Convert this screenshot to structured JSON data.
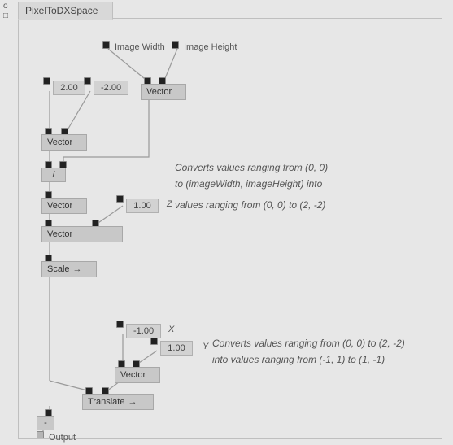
{
  "title": "PixelToDXSpace",
  "side": {
    "o": "o",
    "box": "□"
  },
  "inputs": {
    "image_width": "Image Width",
    "image_height": "Image Height"
  },
  "vals": {
    "two": "2.00",
    "neg_two": "-2.00",
    "one_z": "1.00",
    "neg_one_x": "-1.00",
    "one_y": "1.00"
  },
  "labels": {
    "vector": "Vector",
    "divide": "/",
    "scale": "Scale",
    "translate": "Translate",
    "output": "Output",
    "dash": "-"
  },
  "axes": {
    "z": "Z",
    "x": "X",
    "y": "Y"
  },
  "comments": {
    "c1_l1": "Converts values ranging from (0, 0)",
    "c1_l2": "to (imageWidth, imageHeight) into",
    "c1_l3": "values ranging from (0, 0) to (2, -2)",
    "c2_l1": "Converts values ranging from (0, 0) to (2, -2)",
    "c2_l2": "into values ranging from (-1, 1) to (1, -1)"
  }
}
